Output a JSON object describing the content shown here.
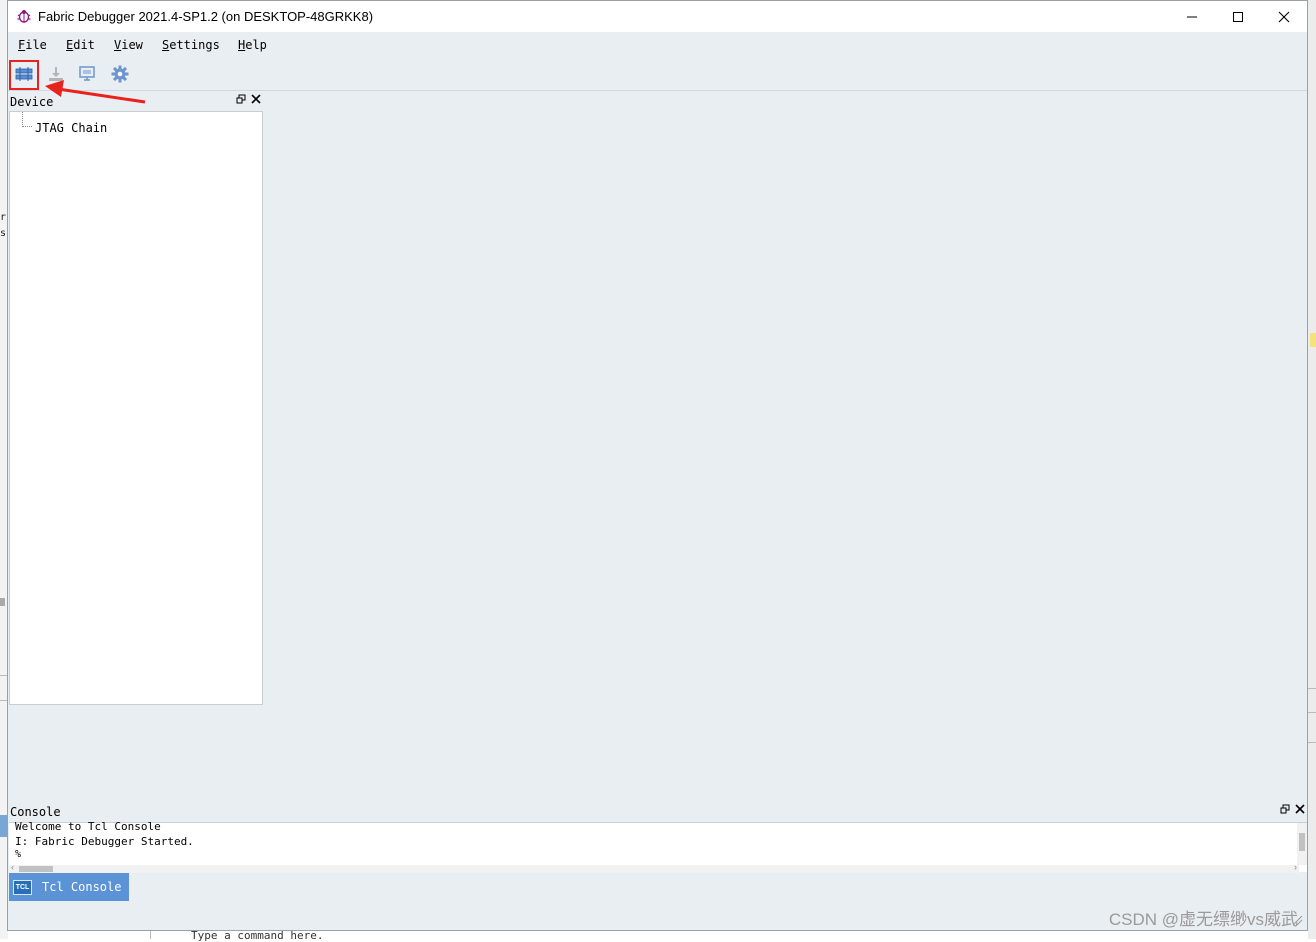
{
  "window": {
    "title": "Fabric Debugger 2021.4-SP1.2 (on DESKTOP-48GRKK8)"
  },
  "menu": {
    "items": [
      {
        "key": "F",
        "rest": "ile"
      },
      {
        "key": "E",
        "rest": "dit"
      },
      {
        "key": "V",
        "rest": "iew"
      },
      {
        "key": "S",
        "rest": "ettings"
      },
      {
        "key": "H",
        "rest": "elp"
      }
    ]
  },
  "toolbar": {
    "icons": [
      "jtag-scan-icon",
      "download-icon",
      "monitor-icon",
      "gear-icon"
    ],
    "highlight_color": "#e8221c"
  },
  "device_panel": {
    "title": "Device",
    "tree": [
      "JTAG Chain"
    ]
  },
  "console_panel": {
    "title": "Console",
    "lines": [
      "Welcome to Tcl Console",
      "I: Fabric Debugger Started.",
      "%"
    ],
    "tab_label": "Tcl Console",
    "tab_icon_text": "TCL"
  },
  "background": {
    "left_glyphs": [
      "r",
      "s"
    ],
    "bottom_text": "Type a command here."
  },
  "watermark": "CSDN @虚无缥缈vs威武"
}
